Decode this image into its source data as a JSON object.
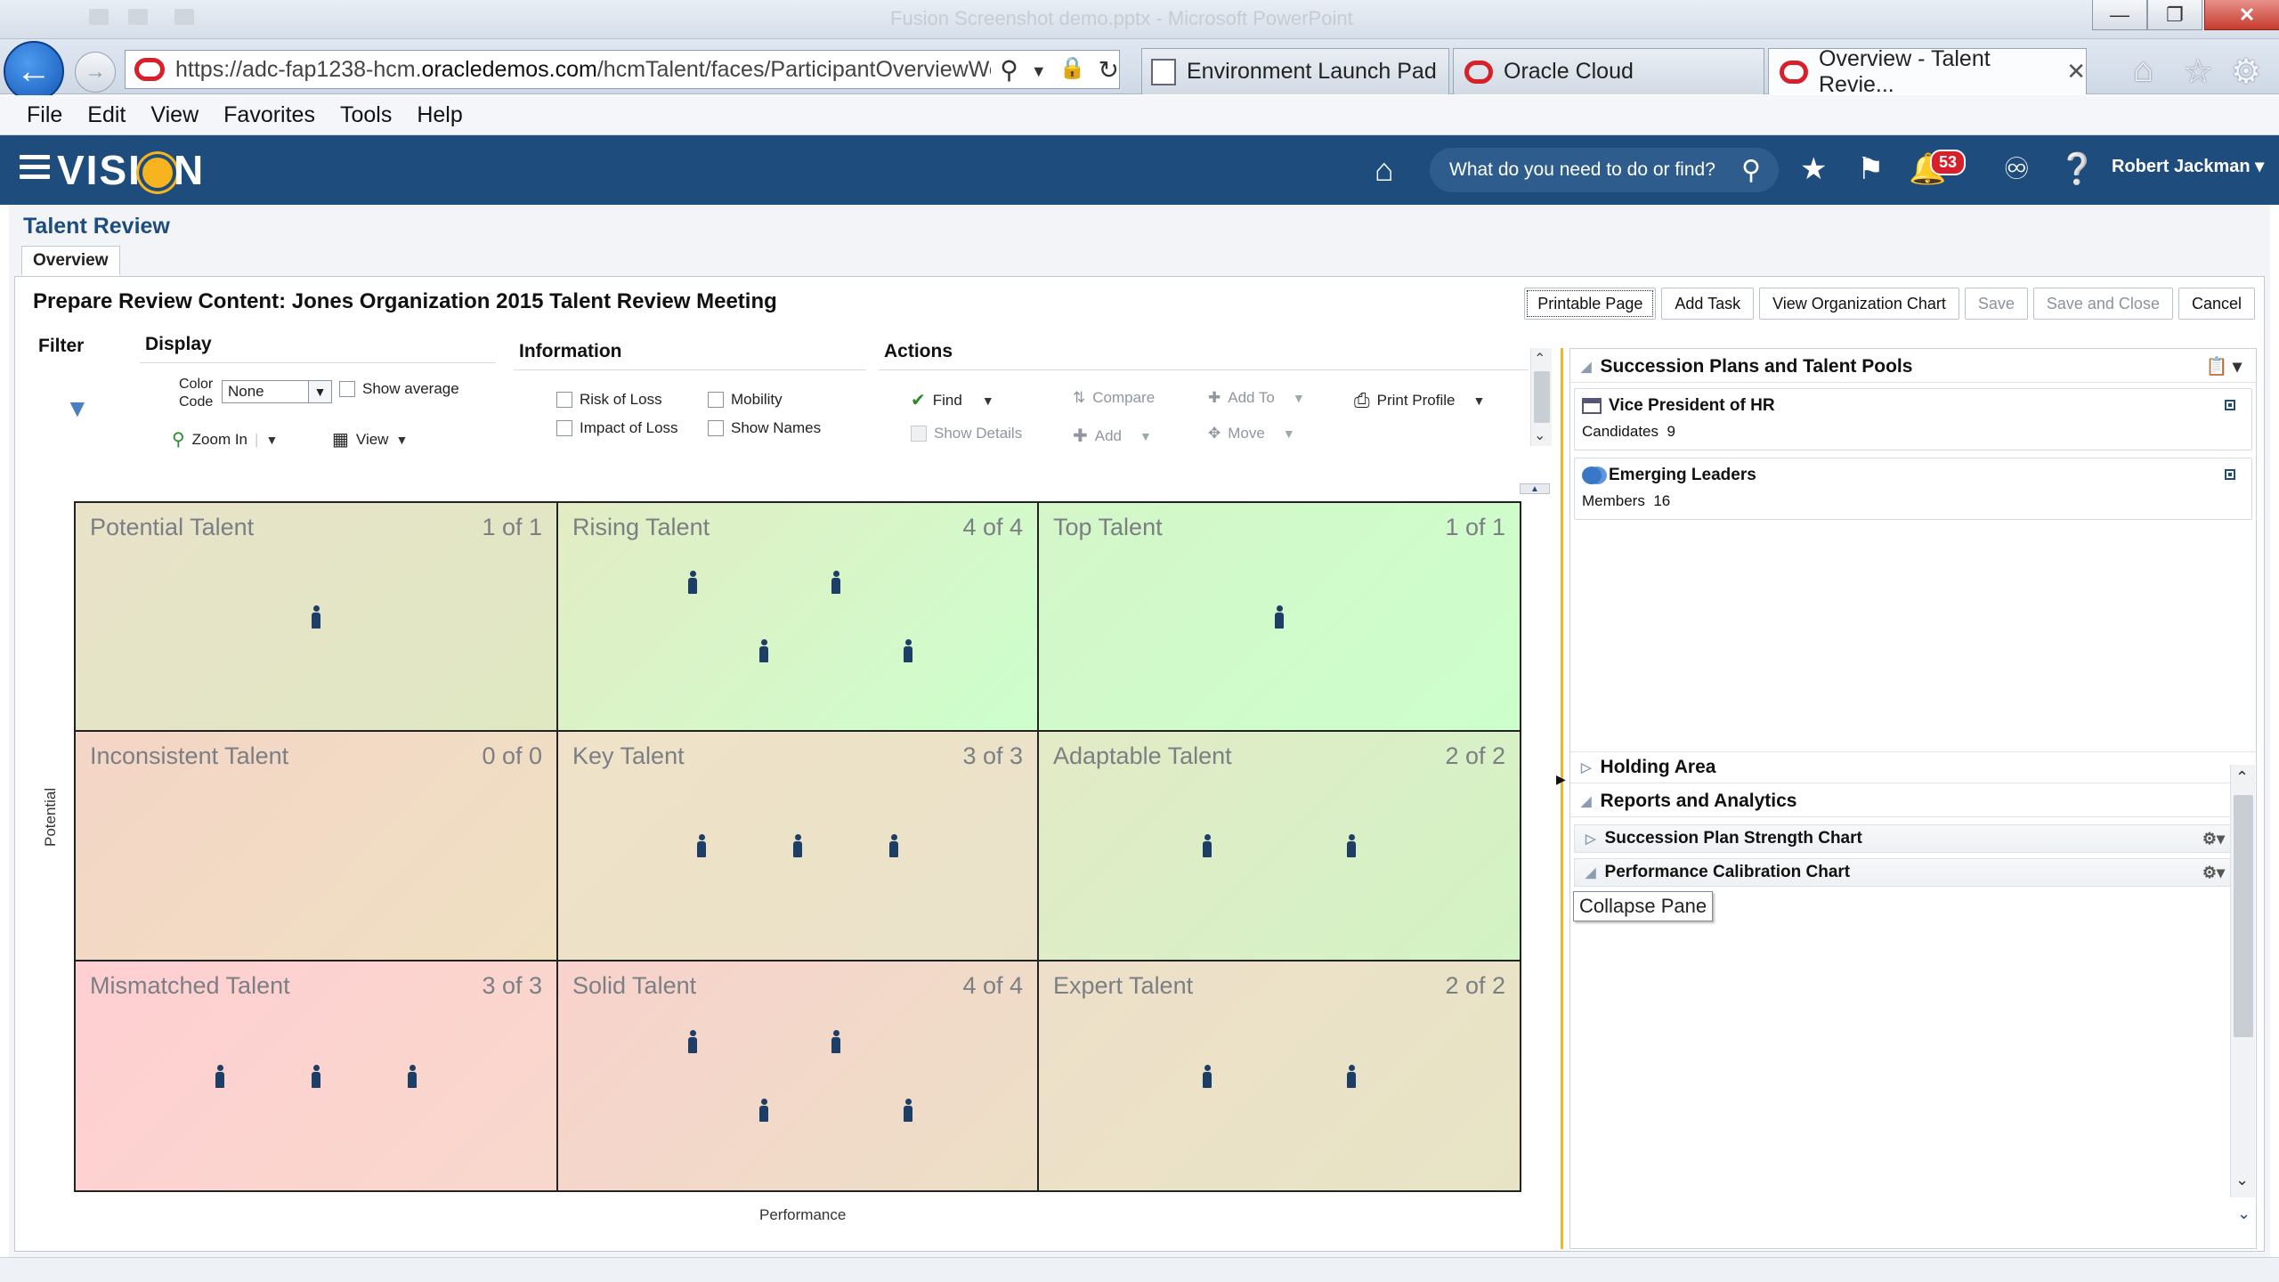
{
  "browser": {
    "window_title": "Fusion Screenshot demo.pptx - Microsoft PowerPoint",
    "url_prefix": "https://adc-fap1238-hcm.",
    "url_domain": "oracledemos.com",
    "url_path": "/hcmTalent/faces/ParticipantOverviewWor",
    "tabs": [
      {
        "label": "Environment Launch Pad"
      },
      {
        "label": "Oracle Cloud"
      },
      {
        "label": "Overview - Talent Revie..."
      }
    ],
    "menu": [
      "File",
      "Edit",
      "View",
      "Favorites",
      "Tools",
      "Help"
    ]
  },
  "app": {
    "brand_left": "VISI",
    "brand_right": "N",
    "search_placeholder": "What do you need to do or find?",
    "notifications": "53",
    "user": "Robert Jackman"
  },
  "page": {
    "title": "Talent Review",
    "tab": "Overview",
    "subtitle": "Prepare Review Content: Jones Organization 2015 Talent Review Meeting",
    "buttons": {
      "printable_page": "Printable Page",
      "add_task": "Add Task",
      "view_org_chart": "View Organization Chart",
      "save": "Save",
      "save_and_close": "Save and Close",
      "cancel": "Cancel"
    }
  },
  "toolbar": {
    "filter": "Filter",
    "display": "Display",
    "information": "Information",
    "actions": "Actions",
    "color_code_label_1": "Color",
    "color_code_label_2": "Code",
    "color_code_value": "None",
    "show_average": "Show average",
    "zoom_in": "Zoom In",
    "view": "View",
    "risk_of_loss": "Risk of Loss",
    "impact_of_loss": "Impact of Loss",
    "mobility": "Mobility",
    "show_names": "Show Names",
    "find": "Find",
    "show_details": "Show Details",
    "compare": "Compare",
    "add": "Add",
    "add_to": "Add To",
    "move": "Move",
    "print_profile": "Print Profile"
  },
  "grid": {
    "y_axis": "Potential",
    "x_axis": "Performance",
    "boxes": [
      {
        "name": "Potential Talent",
        "count": "1 of 1",
        "people": 1
      },
      {
        "name": "Rising Talent",
        "count": "4 of 4",
        "people": 4
      },
      {
        "name": "Top Talent",
        "count": "1 of 1",
        "people": 1
      },
      {
        "name": "Inconsistent Talent",
        "count": "0 of 0",
        "people": 0
      },
      {
        "name": "Key Talent",
        "count": "3 of 3",
        "people": 3
      },
      {
        "name": "Adaptable Talent",
        "count": "2 of 2",
        "people": 2
      },
      {
        "name": "Mismatched Talent",
        "count": "3 of 3",
        "people": 3
      },
      {
        "name": "Solid Talent",
        "count": "4 of 4",
        "people": 4
      },
      {
        "name": "Expert Talent",
        "count": "2 of 2",
        "people": 2
      }
    ],
    "colors": {
      "green": "#ccffcc",
      "beige": "#e9e2c9",
      "pink": "#ffcfd2"
    }
  },
  "right_panel": {
    "succession_header": "Succession Plans and Talent Pools",
    "plan_title": "Vice President of HR",
    "plan_sub_label": "Candidates",
    "plan_sub_value": "9",
    "pool_title": "Emerging Leaders",
    "pool_sub_label": "Members",
    "pool_sub_value": "16",
    "holding_area": "Holding Area",
    "reports": "Reports and Analytics",
    "chart1": "Succession Plan Strength Chart",
    "chart2": "Performance Calibration Chart",
    "tooltip": "Collapse Pane"
  }
}
